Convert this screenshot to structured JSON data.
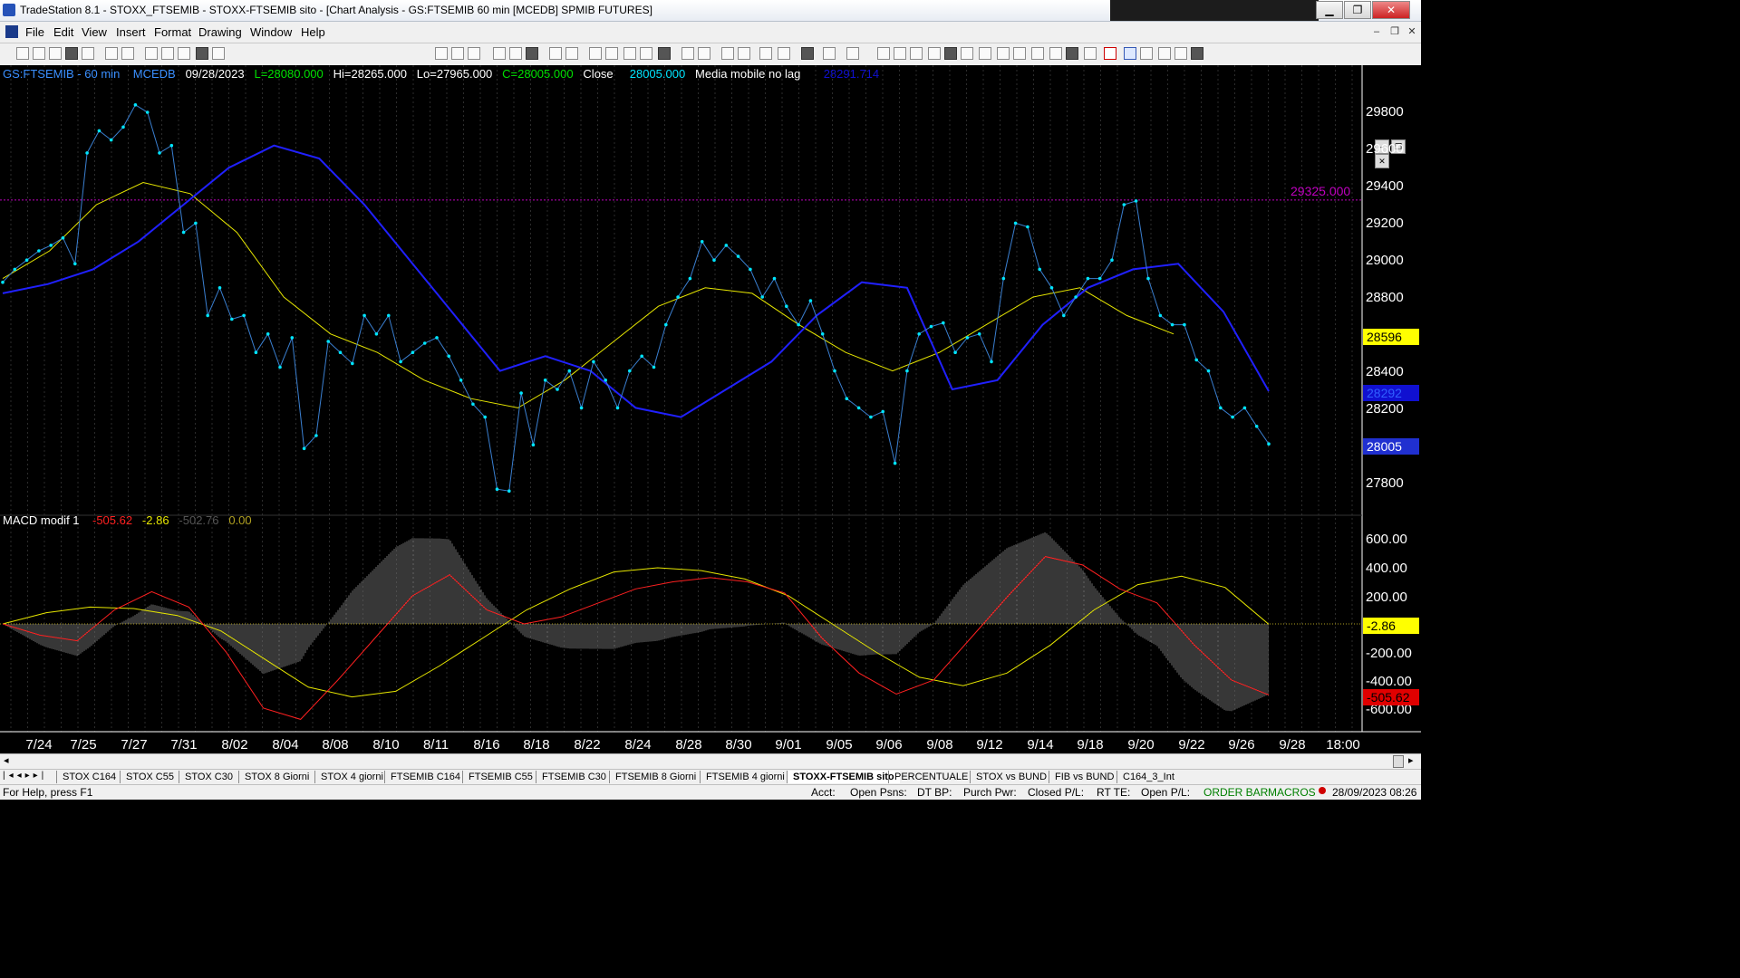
{
  "window": {
    "title": "TradeStation 8.1 - STOXX_FTSEMIB - STOXX-FTSEMIB sito - [Chart Analysis - GS:FTSEMIB  60 min  [MCEDB] SPMIB FUTURES]",
    "minimize": "▁",
    "restore": "❐",
    "close": "✕"
  },
  "menu": [
    "File",
    "Edit",
    "View",
    "Insert",
    "Format",
    "Drawing",
    "Window",
    "Help"
  ],
  "mdi_buttons": [
    "–",
    "❐",
    "✕"
  ],
  "chart_header": {
    "symbol": "GS:FTSEMIB - 60 min",
    "exchange": "MCEDB",
    "date": "09/28/2023",
    "last": "L=28080.000",
    "high": "Hi=28265.000",
    "low": "Lo=27965.000",
    "close": "C=28005.000",
    "close_label": "Close",
    "close_value": "28005.000",
    "indicator": "Media mobile no lag",
    "indicator_value": "28291.714"
  },
  "macd_header": {
    "name": "MACD modif 1",
    "macd": "-505.62",
    "signal": "-2.86",
    "hist": "-502.76",
    "zero": "0.00"
  },
  "price_axis": [
    "29800",
    "29600",
    "29400",
    "29200",
    "29000",
    "28800",
    "28600",
    "28400",
    "28200",
    "28000",
    "27800"
  ],
  "macd_axis": [
    "600.00",
    "400.00",
    "200.00",
    "-200.00",
    "-400.00",
    "-600.00"
  ],
  "price_tags": {
    "line": "29325.000",
    "yellow": "28596",
    "blue": "28292",
    "close": "28005",
    "macd_signal": "-2.86",
    "macd": "-505.62"
  },
  "dates": [
    "7/24",
    "7/25",
    "7/27",
    "7/31",
    "8/02",
    "8/04",
    "8/08",
    "8/10",
    "8/11",
    "8/16",
    "8/18",
    "8/22",
    "8/24",
    "8/28",
    "8/30",
    "9/01",
    "9/05",
    "9/06",
    "9/08",
    "9/12",
    "9/14",
    "9/18",
    "9/20",
    "9/22",
    "9/26",
    "9/28",
    "18:00"
  ],
  "tabs": [
    "STOX C164",
    "STOX C55",
    "STOX  C30",
    "STOX  8 Giorni",
    "STOX 4 giorni",
    "FTSEMIB C164",
    "FTSEMIB C55",
    "FTSEMIB C30",
    "FTSEMIB  8 Giorni",
    "FTSEMIB  4 giorni",
    "STOXX-FTSEMIB sito",
    "PERCENTUALE",
    "STOX vs BUND",
    "FIB vs BUND",
    "C164_3_Int"
  ],
  "active_tab": "STOXX-FTSEMIB sito",
  "status": {
    "help": "For Help, press F1",
    "acct": "Acct:",
    "open_psns": "Open Psns:",
    "dt_bp": "DT BP:",
    "purch_pwr": "Purch Pwr:",
    "closed_pl": "Closed P/L:",
    "rt_te": "RT TE:",
    "open_pl": "Open P/L:",
    "order_bar": "ORDER BAR",
    "macros": "MACROS",
    "datetime": "28/09/2023 08:26"
  },
  "colors": {
    "price": "#00e5ff",
    "ma_blue": "#2020ff",
    "ma_yellow": "#e6e600",
    "macd_red": "#ff2020",
    "signal_yellow": "#e6e600",
    "hist": "#808080",
    "ref_line": "#c000c0"
  },
  "chart_data": {
    "type": "line",
    "price": {
      "ylim": [
        27700,
        29950
      ],
      "ref_line": 29325,
      "close_series": [
        28880,
        28950,
        29000,
        29050,
        29080,
        29120,
        28980,
        29580,
        29700,
        29650,
        29720,
        29840,
        29800,
        29580,
        29620,
        29150,
        29200,
        28700,
        28850,
        28680,
        28700,
        28500,
        28600,
        28420,
        28580,
        27980,
        28050,
        28560,
        28500,
        28440,
        28700,
        28600,
        28700,
        28450,
        28500,
        28550,
        28580,
        28480,
        28350,
        28220,
        28150,
        27760,
        27750,
        28280,
        28000,
        28350,
        28300,
        28400,
        28200,
        28450,
        28350,
        28200,
        28400,
        28480,
        28420,
        28650,
        28800,
        28900,
        29100,
        29000,
        29080,
        29020,
        28950,
        28800,
        28900,
        28750,
        28650,
        28780,
        28600,
        28400,
        28250,
        28200,
        28150,
        28180,
        27900,
        28400,
        28600,
        28640,
        28660,
        28500,
        28580,
        28600,
        28450,
        28900,
        29200,
        29180,
        28950,
        28850,
        28700,
        28800,
        28900,
        28900,
        29000,
        29300,
        29320,
        28900,
        28700,
        28650,
        28650,
        28460,
        28400,
        28200,
        28150,
        28200,
        28100,
        28005
      ],
      "ma_blue": [
        28820,
        28870,
        28950,
        29100,
        29300,
        29500,
        29620,
        29550,
        29300,
        29000,
        28700,
        28400,
        28480,
        28400,
        28200,
        28150,
        28300,
        28450,
        28700,
        28880,
        28850,
        28300,
        28350,
        28650,
        28850,
        28950,
        28980,
        28720,
        28290
      ],
      "ma_yellow": [
        28900,
        29050,
        29300,
        29420,
        29360,
        29150,
        28800,
        28600,
        28500,
        28350,
        28250,
        28200,
        28350,
        28550,
        28750,
        28850,
        28820,
        28650,
        28500,
        28400,
        28500,
        28650,
        28800,
        28850,
        28700,
        28600
      ]
    },
    "macd": {
      "ylim": [
        -700,
        700
      ],
      "macd": [
        0,
        -80,
        -120,
        100,
        230,
        120,
        -200,
        -600,
        -680,
        -400,
        -100,
        200,
        350,
        100,
        0,
        50,
        150,
        250,
        300,
        330,
        300,
        220,
        -100,
        -350,
        -500,
        -400,
        -100,
        200,
        480,
        420,
        250,
        150,
        -150,
        -400,
        -505.62
      ],
      "signal": [
        0,
        80,
        120,
        110,
        60,
        -50,
        -250,
        -450,
        -520,
        -480,
        -300,
        -100,
        100,
        250,
        370,
        400,
        380,
        320,
        200,
        0,
        -200,
        -380,
        -440,
        -350,
        -150,
        100,
        280,
        340,
        260,
        -2.86
      ]
    }
  }
}
